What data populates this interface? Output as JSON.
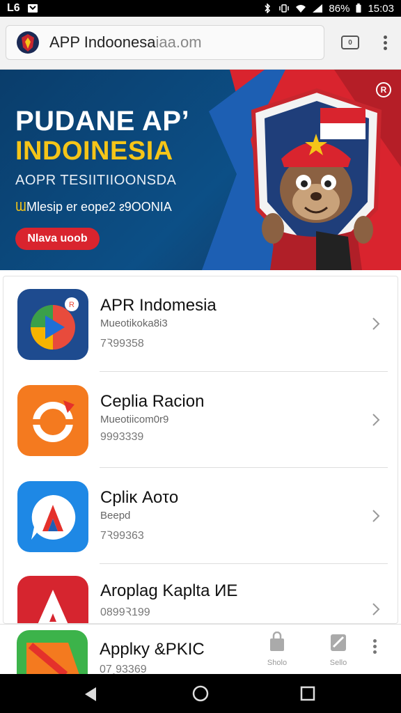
{
  "status_bar": {
    "left_items": [
      "L6"
    ],
    "battery": "86%",
    "time": "15:03"
  },
  "browser": {
    "url_main": "APP Indoonesa",
    "url_dim": "iaa.om",
    "tabs_count": "0"
  },
  "banner": {
    "title_line1": "PUDANE AP’",
    "title_line2": "INDOINESIA",
    "subtitle": "AOPR TESIITIIOONSDA",
    "tagline_accent": "Ɯ",
    "tagline": "Mlesip er eope2 ᴤ9OONIA",
    "cta": "Nlava uoob",
    "reg_mark": "R"
  },
  "apps": [
    {
      "name": "APR Indomesia",
      "developer": "Mueotikoka8i3",
      "count": "7Ꝛ99358"
    },
    {
      "name": "Ceplia Racion",
      "developer": "Mueotiicom0r9",
      "count": "9993339"
    },
    {
      "name": "Cpliκ Aoτo",
      "developer": "Beepd",
      "count": "7Ꝛ99363"
    },
    {
      "name": "Aroplag Kaplta ИE",
      "developer": "",
      "count": "0899Ꝛ199"
    },
    {
      "name": "Applκy &PKIC",
      "developer": "",
      "count": "07ꞈ93369"
    }
  ],
  "bottom_strip": {
    "item1_label": "Sholo",
    "item2_label": "Sello"
  },
  "colors": {
    "banner_blue": "#0c4f86",
    "banner_red": "#d9242e",
    "banner_yellow": "#f5c518"
  }
}
